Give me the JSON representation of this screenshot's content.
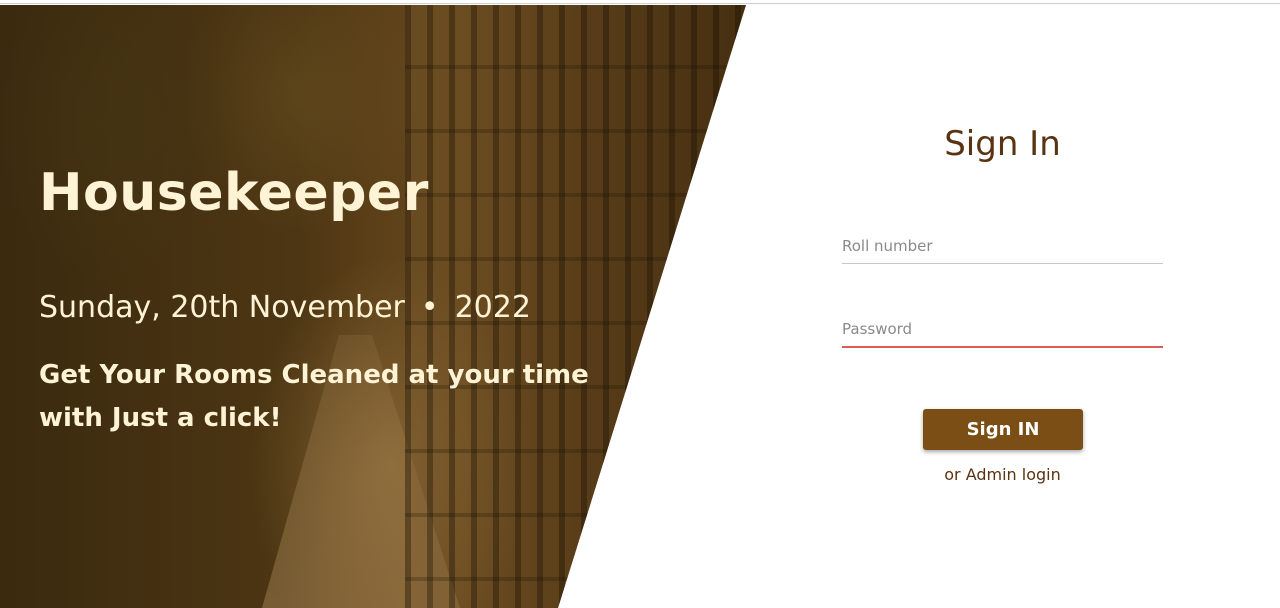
{
  "hero": {
    "title": "Housekeeper",
    "date_text": "Sunday, 20th November",
    "separator": "•",
    "year": "2022",
    "tagline_line1": "Get Your Rooms Cleaned at your time",
    "tagline_line2": "with Just a click!"
  },
  "login": {
    "heading": "Sign In",
    "roll_placeholder": "Roll number",
    "password_placeholder": "Password",
    "submit_label": "Sign IN",
    "admin_link": "or Admin login"
  },
  "colors": {
    "accent": "#7a4e14",
    "heading": "#5a3310",
    "hero_text": "#fff3d6",
    "error_underline": "#e05a5a"
  }
}
